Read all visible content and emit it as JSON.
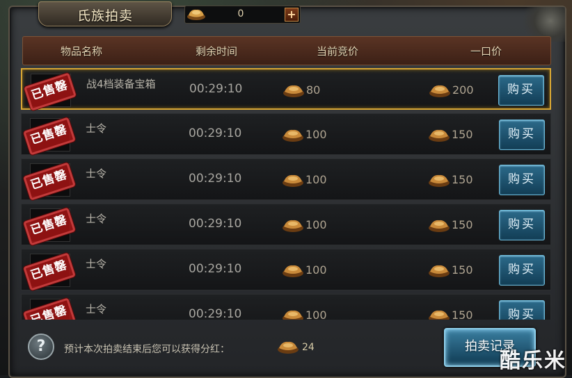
{
  "window": {
    "title": "氏族拍卖"
  },
  "currency": {
    "value": "0",
    "plus_label": "+"
  },
  "columns": [
    "物品名称",
    "剩余时间",
    "当前竞价",
    "一口价"
  ],
  "rows": [
    {
      "name": "战4档装备宝箱",
      "time": "00:29:10",
      "bid": "80",
      "buyout": "200",
      "stamp": "已售罄",
      "button": "购买",
      "selected": true
    },
    {
      "name": "士令",
      "time": "00:29:10",
      "bid": "100",
      "buyout": "150",
      "stamp": "已售罄",
      "button": "购买",
      "selected": false
    },
    {
      "name": "士令",
      "time": "00:29:10",
      "bid": "100",
      "buyout": "150",
      "stamp": "已售罄",
      "button": "购买",
      "selected": false
    },
    {
      "name": "士令",
      "time": "00:29:10",
      "bid": "100",
      "buyout": "150",
      "stamp": "已售罄",
      "button": "购买",
      "selected": false
    },
    {
      "name": "士令",
      "time": "00:29:10",
      "bid": "100",
      "buyout": "150",
      "stamp": "已售罄",
      "button": "购买",
      "selected": false
    },
    {
      "name": "士令",
      "time": "00:29:10",
      "bid": "100",
      "buyout": "150",
      "stamp": "已售罄",
      "button": "购买",
      "selected": false
    }
  ],
  "footer": {
    "help_icon": "question-icon",
    "text": "预计本次拍卖结束后您可以获得分红：",
    "value": "24",
    "record_button": "拍卖记录"
  },
  "watermark": "酷乐米",
  "colors": {
    "selected_border": "#d8a634",
    "stamp_red": "#c23a3a",
    "button_blue": "#2c6a8a",
    "header_brown": "#5a3424"
  }
}
